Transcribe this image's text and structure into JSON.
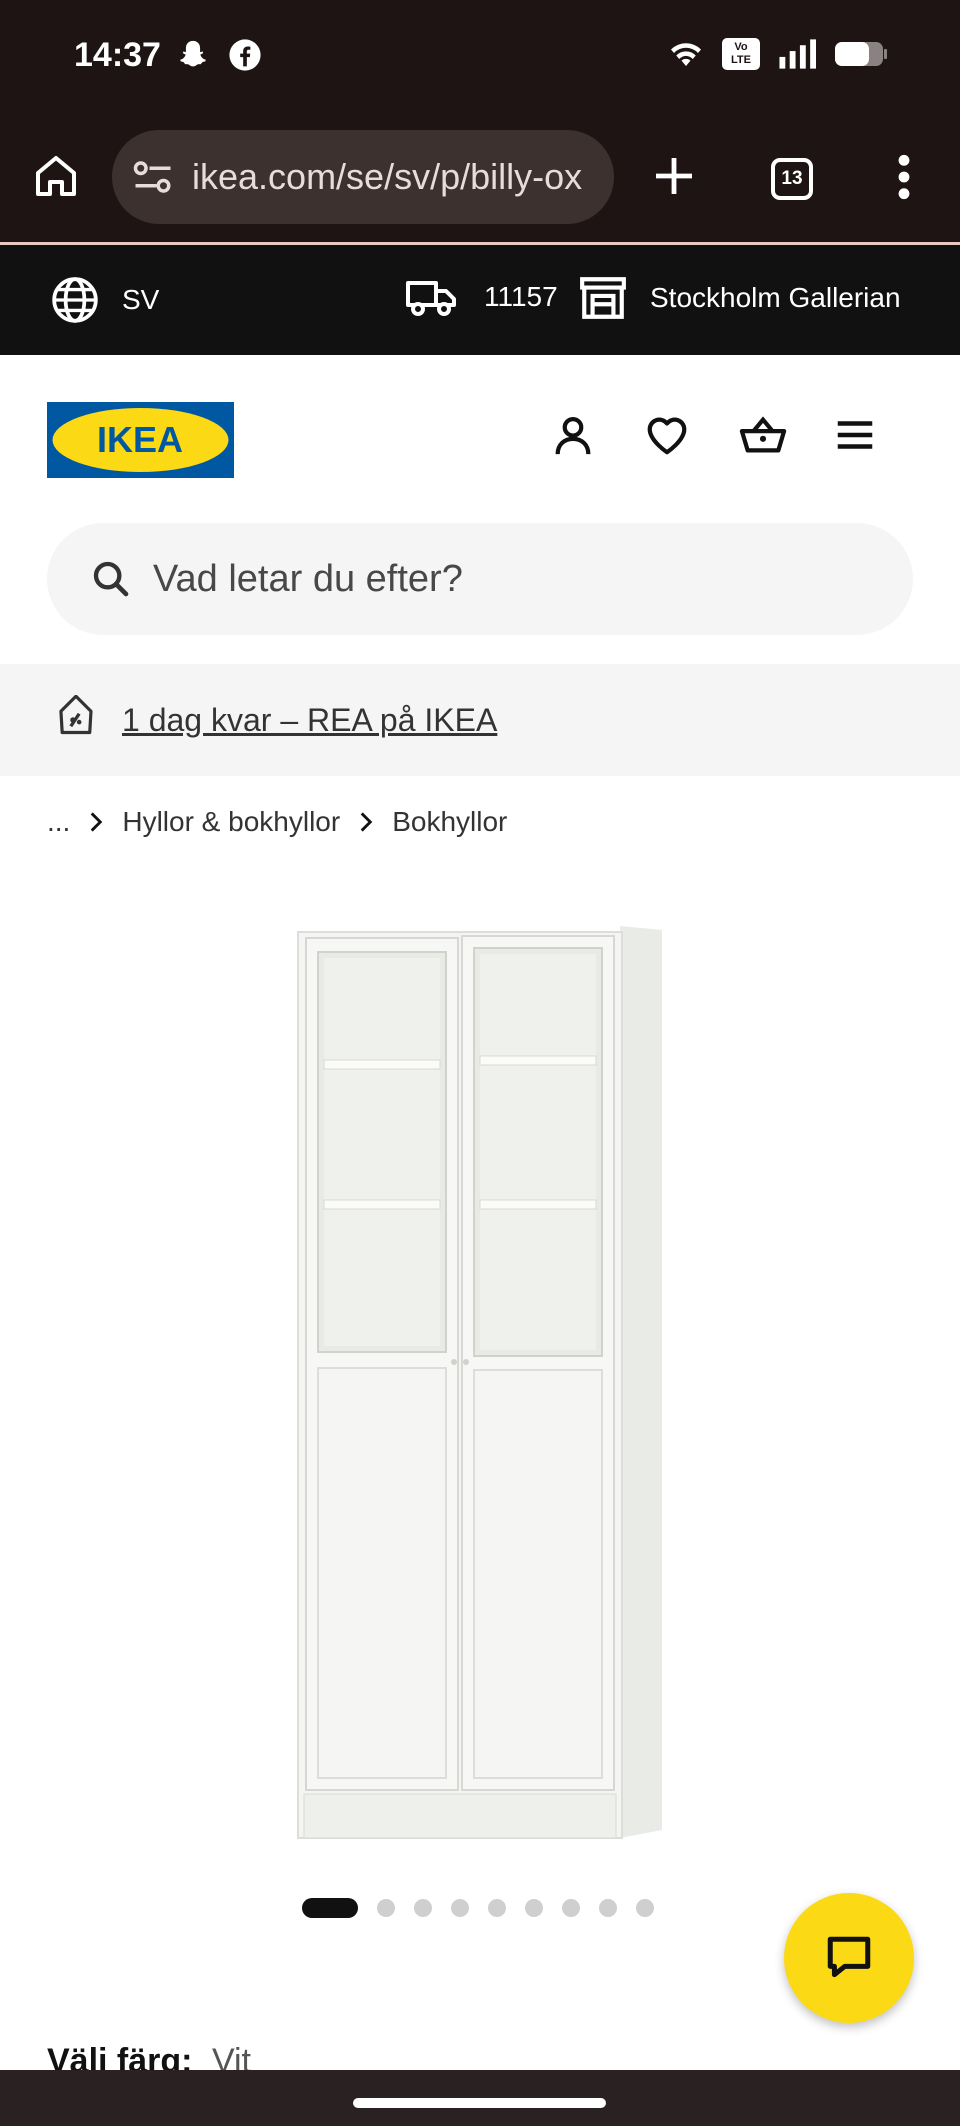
{
  "status_bar": {
    "time": "14:37",
    "icons": [
      "snapchat-icon",
      "facebook-icon",
      "wifi-icon",
      "volte-icon",
      "signal-icon",
      "battery-icon"
    ],
    "volte_text_1": "Vo",
    "volte_text_2": "LTE"
  },
  "browser": {
    "url": "ikea.com/se/sv/p/billy-ox",
    "tab_count": "13"
  },
  "top_strip": {
    "language": "SV",
    "zip": "11157",
    "store": "Stockholm Gallerian"
  },
  "header": {
    "logo_text": "IKEA"
  },
  "search": {
    "placeholder": "Vad letar du efter?"
  },
  "promo": {
    "text": "1 dag kvar – REA på IKEA"
  },
  "breadcrumb": {
    "items": [
      "...",
      "Hyllor & bokhyllor",
      "Bokhyllor"
    ]
  },
  "carousel": {
    "total": 9,
    "active": 1
  },
  "color": {
    "label": "Välj färg:",
    "value": "Vit"
  },
  "colors": {
    "system_bar": "#1f1414",
    "ikea_blue": "#0058a3",
    "ikea_yellow": "#fbd914",
    "strip": "#111111"
  }
}
